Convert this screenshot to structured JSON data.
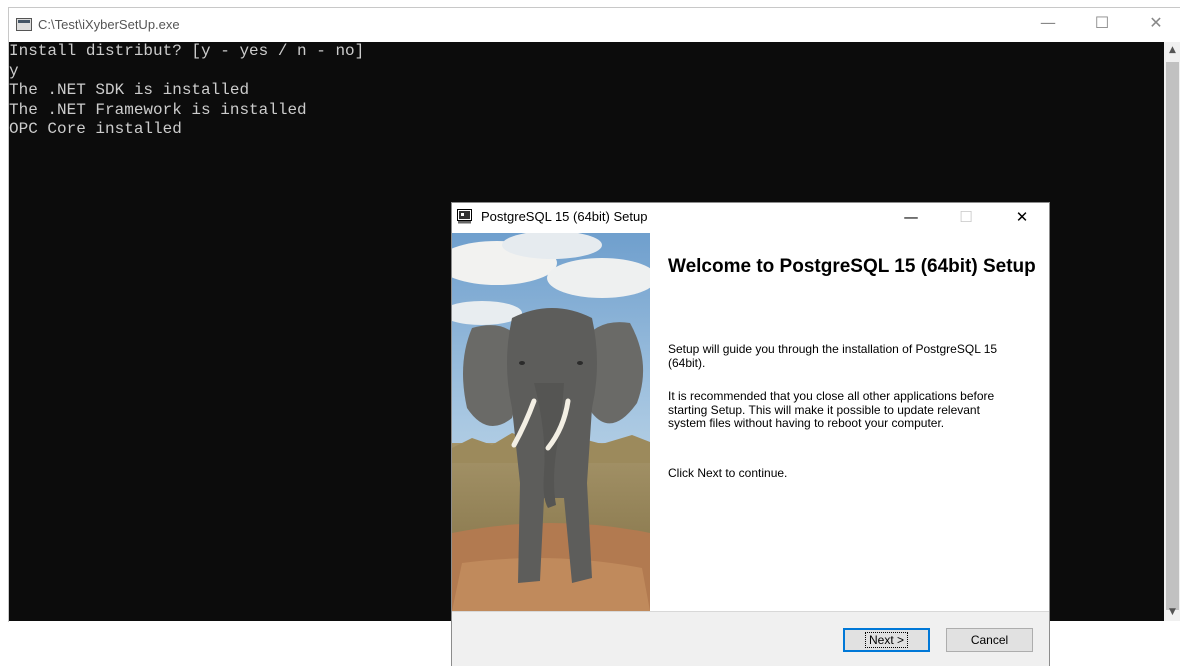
{
  "console": {
    "title": "C:\\Test\\iXyberSetUp.exe",
    "lines": [
      "Install distribut? [y - yes / n - no]",
      "y",
      "The .NET SDK is installed",
      "The .NET Framework is installed",
      "OPC Core installed"
    ],
    "controls": {
      "minimize": "—",
      "maximize": "☐",
      "close": "✕"
    }
  },
  "dialog": {
    "title": "PostgreSQL 15 (64bit) Setup",
    "heading": "Welcome to PostgreSQL 15 (64bit) Setup",
    "paragraphs": [
      "Setup will guide you through the installation of PostgreSQL 15 (64bit).",
      "It is recommended that you close all other applications before starting Setup. This will make it possible to update relevant system files without having to reboot your computer.",
      "Click Next to continue."
    ],
    "buttons": {
      "next": "Next >",
      "cancel": "Cancel"
    },
    "controls": {
      "minimize": "—",
      "maximize": "☐",
      "close": "✕"
    },
    "side_image": "elephant-photo"
  },
  "colors": {
    "console_bg": "#0c0c0c",
    "console_text": "#cccccc",
    "default_button_border": "#0078d7"
  }
}
